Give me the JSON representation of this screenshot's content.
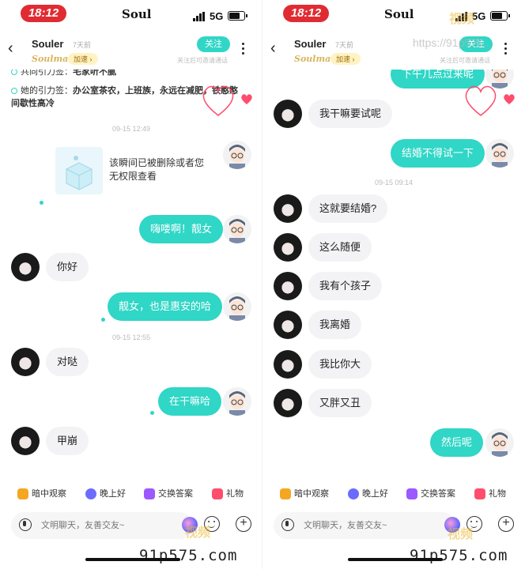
{
  "status": {
    "time": "18:12",
    "app_name": "Soul",
    "network": "5G"
  },
  "header": {
    "name": "Souler",
    "last_active": "7天前",
    "soulmate": "Soulmate",
    "speedup": "加速 ›",
    "follow": "关注",
    "follow_hint": "关注后可邀请通话"
  },
  "left": {
    "tags": [
      {
        "label": "共同引力签：",
        "value": "宅家听不腻"
      },
      {
        "label": "她的引力签：",
        "value": "办公室茶农，上班族，永远在减肥，铁憨憨"
      },
      {
        "label": "",
        "value": "间歇性高冷"
      }
    ],
    "deleted_card": "该瞬间已被删除或者您无权限查看",
    "timestamps": [
      "09-15 12:49",
      "09-15 12:55"
    ],
    "messages": [
      {
        "side": "out",
        "text": "嗨喽啊！靓女"
      },
      {
        "side": "in",
        "text": "你好"
      },
      {
        "side": "out",
        "text": "靓女，也是惠安的哈"
      },
      {
        "side": "in",
        "text": "对哒"
      },
      {
        "side": "out",
        "text": "在干嘛哈"
      },
      {
        "side": "in",
        "text": "甲崩"
      }
    ]
  },
  "right": {
    "timestamps": [
      "09-15 09:14"
    ],
    "messages": [
      {
        "side": "out",
        "text": "下午几点过来呢"
      },
      {
        "side": "in",
        "text": "我干嘛要试呢"
      },
      {
        "side": "out",
        "text": "结婚不得试一下"
      },
      {
        "side": "in",
        "text": "这就要结婚?"
      },
      {
        "side": "in",
        "text": "这么随便"
      },
      {
        "side": "in",
        "text": "我有个孩子"
      },
      {
        "side": "in",
        "text": "我离婚"
      },
      {
        "side": "in",
        "text": "我比你大"
      },
      {
        "side": "in",
        "text": "又胖又丑"
      },
      {
        "side": "out",
        "text": "然后呢"
      }
    ]
  },
  "actions": [
    {
      "label": "暗中观察",
      "icon": "binoculars-icon",
      "color": "#f5a623"
    },
    {
      "label": "晚上好",
      "icon": "moon-icon",
      "color": "#6b6bff"
    },
    {
      "label": "交换答案",
      "icon": "chat-swap-icon",
      "color": "#9b59ff"
    },
    {
      "label": "礼物",
      "icon": "gift-icon",
      "color": "#ff4d6d"
    }
  ],
  "input": {
    "placeholder": "文明聊天，友善交友~"
  },
  "watermark": {
    "text": "91p575.com",
    "logo": "视频",
    "url": "https://91p575..."
  }
}
